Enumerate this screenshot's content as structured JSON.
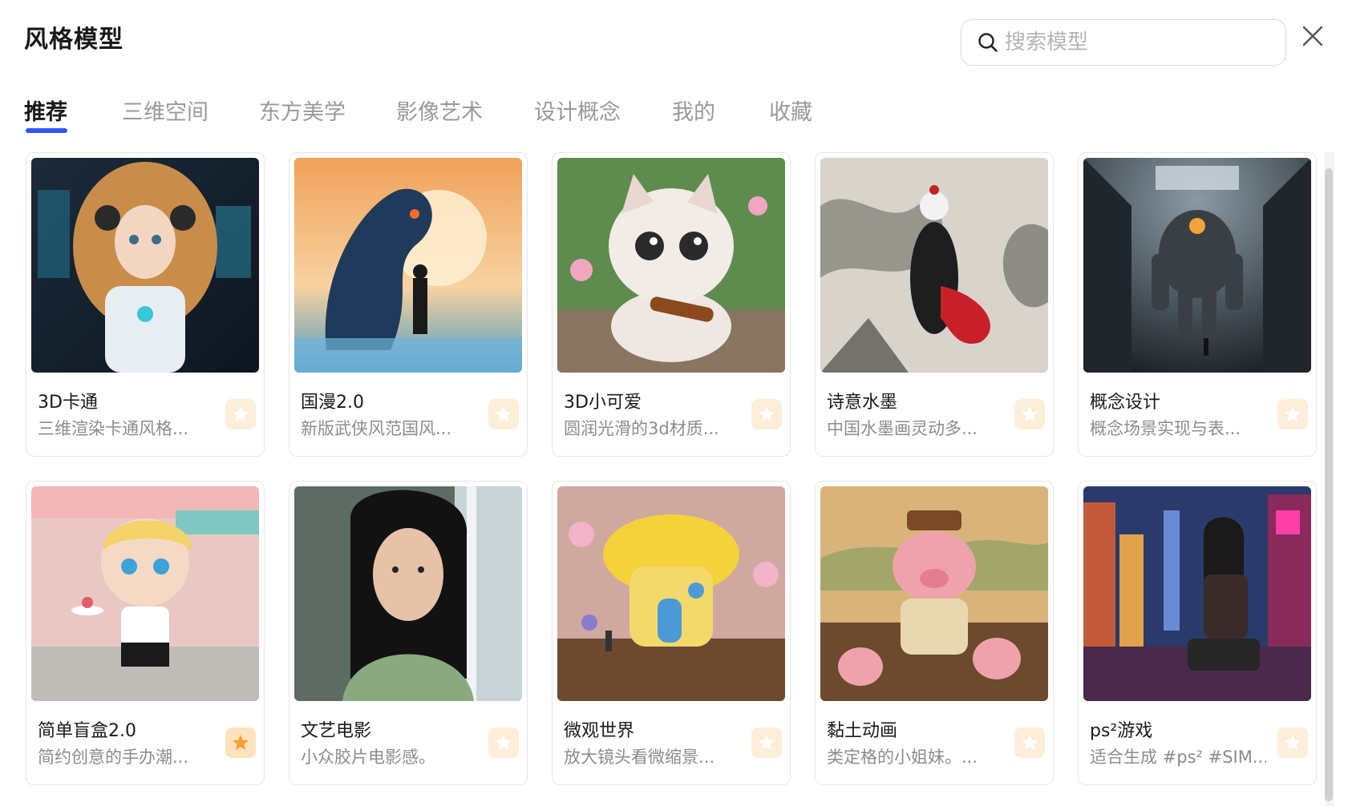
{
  "header": {
    "title": "风格模型"
  },
  "search": {
    "placeholder": "搜索模型",
    "value": ""
  },
  "tabs": [
    {
      "label": "推荐",
      "active": true
    },
    {
      "label": "三维空间",
      "active": false
    },
    {
      "label": "东方美学",
      "active": false
    },
    {
      "label": "影像艺术",
      "active": false
    },
    {
      "label": "设计概念",
      "active": false
    },
    {
      "label": "我的",
      "active": false
    },
    {
      "label": "收藏",
      "active": false
    }
  ],
  "cards": [
    {
      "title": "3D卡通",
      "desc": "三维渲染卡通风格...",
      "favorited": false
    },
    {
      "title": "国漫2.0",
      "desc": "新版武侠风范国风...",
      "favorited": false
    },
    {
      "title": "3D小可爱",
      "desc": "圆润光滑的3d材质...",
      "favorited": false
    },
    {
      "title": "诗意水墨",
      "desc": "中国水墨画灵动多...",
      "favorited": false
    },
    {
      "title": "概念设计",
      "desc": "概念场景实现与表...",
      "favorited": false
    },
    {
      "title": "简单盲盒2.0",
      "desc": "简约创意的手办潮...",
      "favorited": true
    },
    {
      "title": "文艺电影",
      "desc": "小众胶片电影感。",
      "favorited": false
    },
    {
      "title": "微观世界",
      "desc": "放大镜头看微缩景...",
      "favorited": false
    },
    {
      "title": "黏土动画",
      "desc": "类定格的小姐妹。...",
      "favorited": false
    },
    {
      "title": "ps²游戏",
      "desc": "适合生成 #ps² #SIM...",
      "favorited": false
    }
  ],
  "colors": {
    "accent": "#3355ff",
    "star_on": "#f7a13a",
    "star_off": "#ffffff",
    "fav_bg": "#fdeed9"
  },
  "icons": {
    "search": "search-icon",
    "close": "close-icon",
    "favorite": "star-icon"
  }
}
